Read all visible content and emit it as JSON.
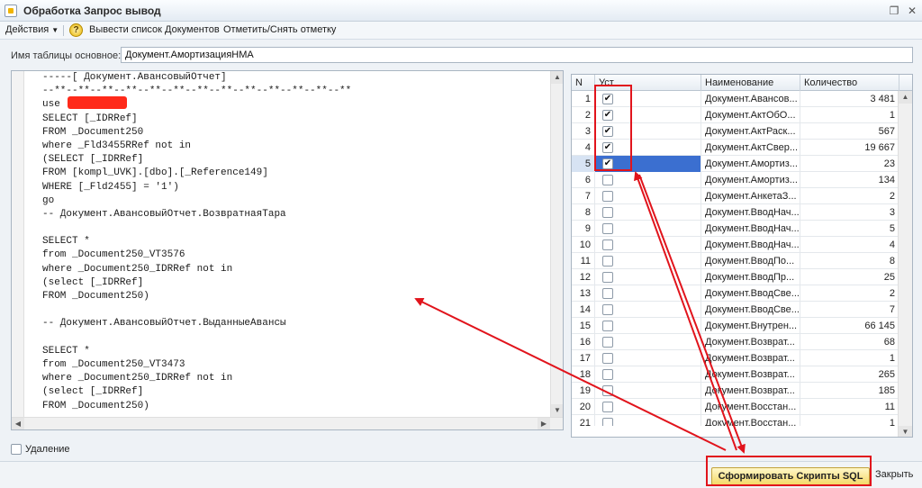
{
  "window": {
    "title": "Обработка  Запрос вывод",
    "controls": {
      "restore": "❐",
      "close": "✕"
    }
  },
  "toolbar": {
    "actions_label": "Действия",
    "help_glyph": "?",
    "list_docs_label": "Вывести список Документов",
    "toggle_mark_label": "Отметить/Снять отметку"
  },
  "table_field": {
    "label": "Имя таблицы основное:",
    "value": "Документ.АмортизацияНМА"
  },
  "editor": {
    "lines": [
      "-----[ Документ.АвансовыйОтчет]",
      "--**--**--**--**--**--**--**--**--**--**--**--**--**",
      "use ",
      "SELECT [_IDRRef]",
      "FROM _Document250",
      "where _Fld3455RRef not in",
      "(SELECT [_IDRRef]",
      "FROM [kompl_UVK].[dbo].[_Reference149]",
      "WHERE [_Fld2455] = '1')",
      "go",
      "-- Документ.АвансовыйОтчет.ВозвратнаяТара",
      "",
      "SELECT *",
      "from _Document250_VT3576",
      "where _Document250_IDRRef not in",
      "(select [_IDRRef]",
      "FROM _Document250)",
      "",
      "-- Документ.АвансовыйОтчет.ВыданныеАвансы",
      "",
      "SELECT *",
      "from _Document250_VT3473",
      "where _Document250_IDRRef not in",
      "(select [_IDRRef]",
      "FROM _Document250)"
    ]
  },
  "grid": {
    "columns": {
      "n": "N",
      "mark": "Уст",
      "name": "Наименование",
      "qty": "Количество"
    },
    "rows": [
      {
        "n": "1",
        "checked": true,
        "name": "Документ.Авансов...",
        "qty": "3 481"
      },
      {
        "n": "2",
        "checked": true,
        "name": "Документ.АктОбО...",
        "qty": "1"
      },
      {
        "n": "3",
        "checked": true,
        "name": "Документ.АктРаск...",
        "qty": "567"
      },
      {
        "n": "4",
        "checked": true,
        "name": "Документ.АктСвер...",
        "qty": "19 667"
      },
      {
        "n": "5",
        "checked": true,
        "name": "Документ.Амортиз...",
        "qty": "23"
      },
      {
        "n": "6",
        "checked": false,
        "name": "Документ.Амортиз...",
        "qty": "134"
      },
      {
        "n": "7",
        "checked": false,
        "name": "Документ.АнкетаЗ...",
        "qty": "2"
      },
      {
        "n": "8",
        "checked": false,
        "name": "Документ.ВводНач...",
        "qty": "3"
      },
      {
        "n": "9",
        "checked": false,
        "name": "Документ.ВводНач...",
        "qty": "5"
      },
      {
        "n": "10",
        "checked": false,
        "name": "Документ.ВводНач...",
        "qty": "4"
      },
      {
        "n": "11",
        "checked": false,
        "name": "Документ.ВводПо...",
        "qty": "8"
      },
      {
        "n": "12",
        "checked": false,
        "name": "Документ.ВводПр...",
        "qty": "25"
      },
      {
        "n": "13",
        "checked": false,
        "name": "Документ.ВводСве...",
        "qty": "2"
      },
      {
        "n": "14",
        "checked": false,
        "name": "Документ.ВводСве...",
        "qty": "7"
      },
      {
        "n": "15",
        "checked": false,
        "name": "Документ.Внутрен...",
        "qty": "66 145"
      },
      {
        "n": "16",
        "checked": false,
        "name": "Документ.Возврат...",
        "qty": "68"
      },
      {
        "n": "17",
        "checked": false,
        "name": "Документ.Возврат...",
        "qty": "1"
      },
      {
        "n": "18",
        "checked": false,
        "name": "Документ.Возврат...",
        "qty": "265"
      },
      {
        "n": "19",
        "checked": false,
        "name": "Документ.Возврат...",
        "qty": "185"
      },
      {
        "n": "20",
        "checked": false,
        "name": "Документ.Восстан...",
        "qty": "11"
      },
      {
        "n": "21",
        "checked": false,
        "name": "Документ.Восстан...",
        "qty": "1"
      }
    ],
    "selected_row": 5
  },
  "options": {
    "delete_label": "Удаление"
  },
  "buttons": {
    "generate_label": "Сформировать Скрипты SQL",
    "close_label": "Закрыть"
  },
  "colors": {
    "annotation_red": "#e1141c",
    "selection_blue": "#3b6fd0",
    "primary_button": "#f4d969"
  }
}
